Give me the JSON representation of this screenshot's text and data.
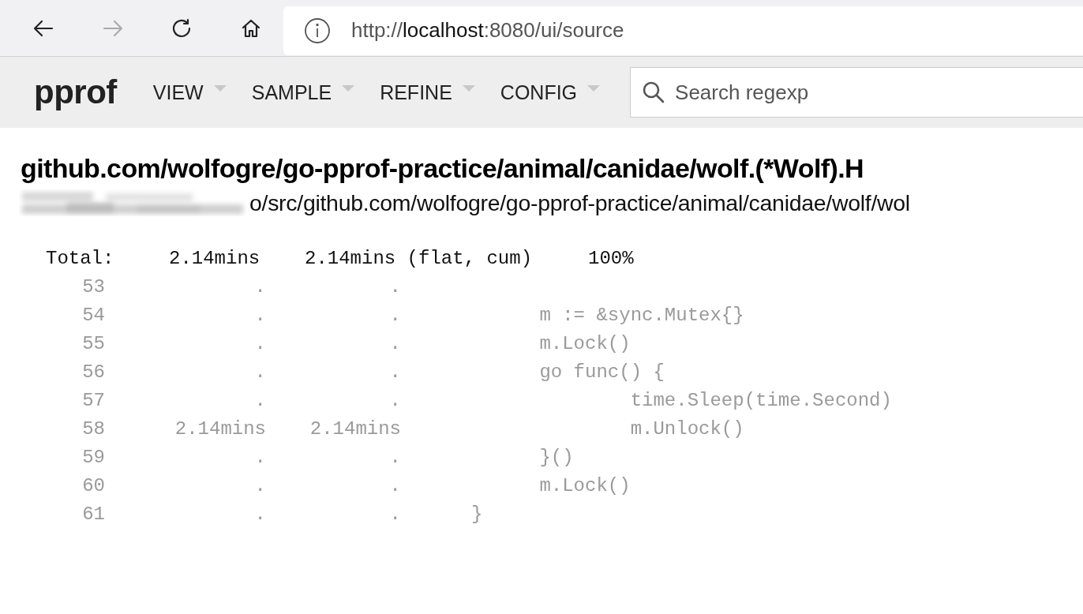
{
  "browser": {
    "nav_buttons": [
      {
        "kind": "back",
        "disabled": false
      },
      {
        "kind": "forward",
        "disabled": true
      },
      {
        "kind": "reload",
        "disabled": false
      },
      {
        "kind": "home",
        "disabled": false
      }
    ],
    "url": {
      "scheme": "http://",
      "host": "localhost",
      "rest": ":8080/ui/source"
    }
  },
  "toolbar": {
    "logo": "pprof",
    "menus": [
      "VIEW",
      "SAMPLE",
      "REFINE",
      "CONFIG"
    ],
    "search": {
      "placeholder": "Search regexp"
    }
  },
  "function_title": "github.com/wolfogre/go-pprof-practice/animal/canidae/wolf.(*Wolf).H",
  "file_path": {
    "redacted": true,
    "text": "o/src/github.com/wolfogre/go-pprof-practice/animal/canidae/wolf/wol"
  },
  "listing": {
    "total": {
      "label": "Total:",
      "flat": "2.14mins",
      "cum": "2.14mins (flat, cum)",
      "percent": "100%"
    },
    "rows": [
      {
        "line": "53",
        "flat": ".",
        "cum": ".",
        "code": ""
      },
      {
        "line": "54",
        "flat": ".",
        "cum": ".",
        "code": "      m := &sync.Mutex{}"
      },
      {
        "line": "55",
        "flat": ".",
        "cum": ".",
        "code": "      m.Lock()"
      },
      {
        "line": "56",
        "flat": ".",
        "cum": ".",
        "code": "      go func() {"
      },
      {
        "line": "57",
        "flat": ".",
        "cum": ".",
        "code": "              time.Sleep(time.Second)"
      },
      {
        "line": "58",
        "flat": "2.14mins",
        "cum": "2.14mins",
        "code": "              m.Unlock()"
      },
      {
        "line": "59",
        "flat": ".",
        "cum": ".",
        "code": "      }()"
      },
      {
        "line": "60",
        "flat": ".",
        "cum": ".",
        "code": "      m.Lock()"
      },
      {
        "line": "61",
        "flat": ".",
        "cum": ".",
        "code": "}"
      }
    ]
  }
}
